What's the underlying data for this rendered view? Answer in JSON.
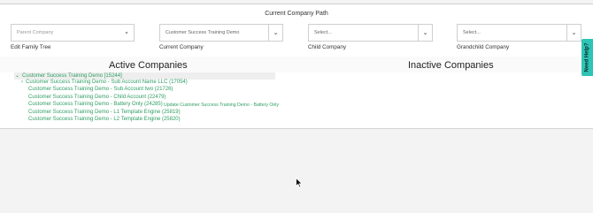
{
  "header": {
    "title": "Current Company Path"
  },
  "selectors": [
    {
      "value": "Parent Company",
      "label": "Edit Family Tree"
    },
    {
      "value": "Customer Success Training Demo",
      "label": "Current Company"
    },
    {
      "value": "Select...",
      "label": "Child Company"
    },
    {
      "value": "Select...",
      "label": "Grandchild Company"
    }
  ],
  "columns": {
    "active": "Active Companies",
    "inactive": "Inactive Companies"
  },
  "tree": [
    {
      "label": "Customer Success Training Demo [15244]",
      "caret": "⌄"
    },
    {
      "label": "Customer Success Training Demo - Sub Account Name LLC (17054)",
      "caret": "›"
    },
    {
      "label": "Customer Success Training Demo - Sub Account two (21726)"
    },
    {
      "label": "Customer Success Training Demo - Child Account (22479)"
    },
    {
      "label": "Customer Success Training Demo - Battery Only (24285)",
      "action": "Update Customer Success Training Demo - Battery Only"
    },
    {
      "label": "Customer Success Training Demo - L1 Template Engine (25819)"
    },
    {
      "label": "Customer Success Training Demo - L2 Template Engine (25820)"
    }
  ],
  "help": {
    "label": "Need Help?"
  },
  "colors": {
    "accent": "#2f9e63",
    "help_tab": "#2ec4b6"
  }
}
